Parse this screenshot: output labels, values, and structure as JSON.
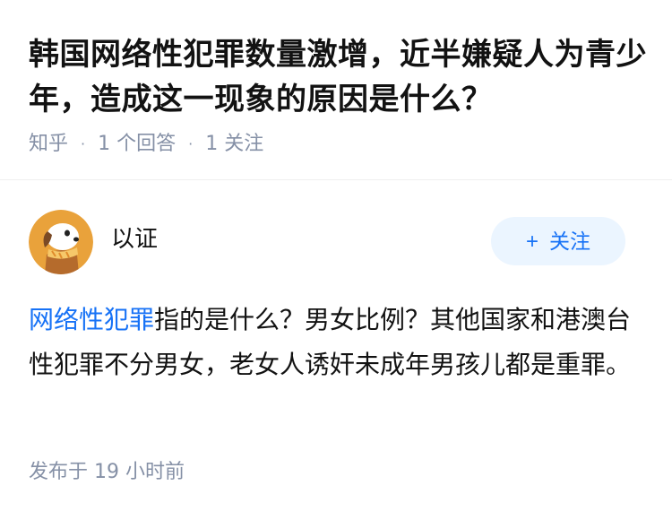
{
  "question": {
    "title": "韩国网络性犯罪数量激增，近半嫌疑人为青少年，造成这一现象的原因是什么？",
    "source": "知乎",
    "answers": "1 个回答",
    "followers": "1 关注"
  },
  "answer": {
    "author": "以证",
    "follow_plus": "+",
    "follow_label": "关注",
    "link_text": "网络性犯罪",
    "body": "指的是什么？男女比例？其他国家和港澳台性犯罪不分男女，老女人诱奸未成年男孩儿都是重罪。",
    "published": "发布于  19 小时前"
  },
  "colors": {
    "accent": "#1772f6",
    "meta": "#8590a6",
    "button_bg": "#ebf5ff"
  },
  "icons": {
    "avatar": "cartoon-dog-avatar"
  }
}
